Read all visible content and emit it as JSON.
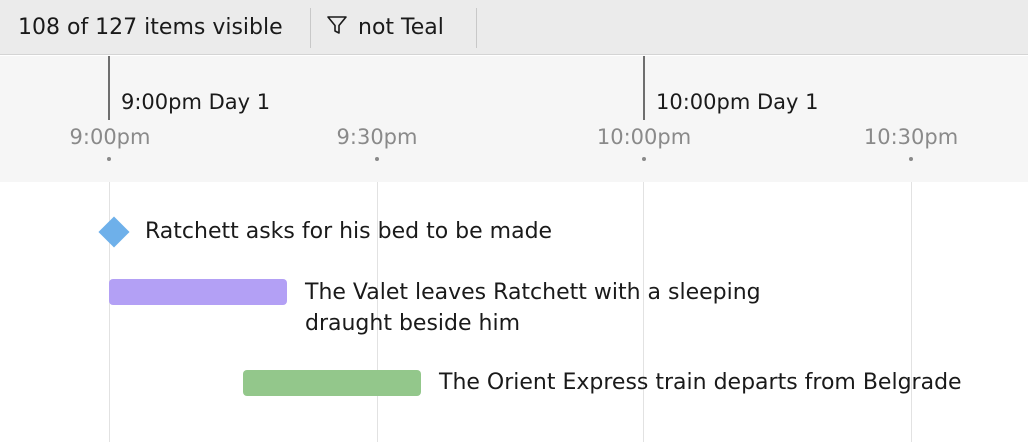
{
  "toolbar": {
    "visible_count_text": "108 of 127 items visible",
    "filter_text": "not Teal",
    "filter_icon": "filter-icon"
  },
  "timeline": {
    "major_ticks": [
      {
        "label": "9:00pm Day 1"
      },
      {
        "label": "10:00pm Day 1"
      }
    ],
    "minor_ticks": [
      {
        "label": "9:00pm"
      },
      {
        "label": "9:30pm"
      },
      {
        "label": "10:00pm"
      },
      {
        "label": "10:30pm"
      }
    ]
  },
  "events": [
    {
      "kind": "milestone",
      "label": "Ratchett asks for his bed to be made",
      "color": "#6eb0ea"
    },
    {
      "kind": "span",
      "label": "The Valet leaves Ratchett with a sleeping draught beside him",
      "color": "#b3a0f5"
    },
    {
      "kind": "span",
      "label": "The Orient Express train departs from Belgrade",
      "color": "#93c78b"
    }
  ]
}
